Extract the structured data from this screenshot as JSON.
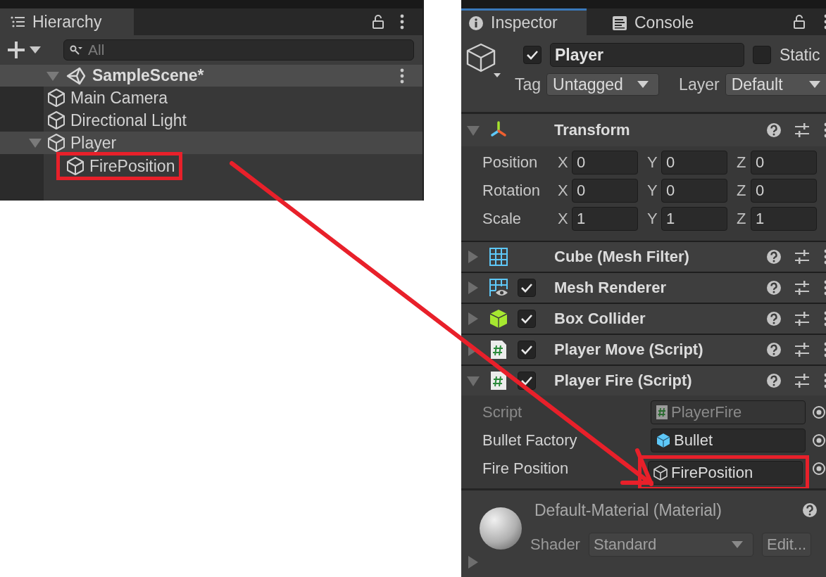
{
  "hierarchy": {
    "title": "Hierarchy",
    "search": {
      "placeholder": "All"
    },
    "scene": {
      "name": "SampleScene*",
      "expanded": true,
      "children": [
        {
          "name": "Main Camera",
          "selected": false,
          "annotated": false
        },
        {
          "name": "Directional Light",
          "selected": false,
          "annotated": false
        },
        {
          "name": "Player",
          "selected": true,
          "annotated": false,
          "expanded": true,
          "children": [
            {
              "name": "FirePosition",
              "selected": false,
              "annotated": true
            }
          ]
        }
      ]
    }
  },
  "inspector": {
    "tabs": [
      {
        "label": "Inspector",
        "selected": true
      },
      {
        "label": "Console",
        "selected": false
      }
    ],
    "object": {
      "active": true,
      "name": "Player",
      "static": false,
      "static_label": "Static",
      "tag_label": "Tag",
      "tag": "Untagged",
      "layer_label": "Layer",
      "layer": "Default"
    },
    "components": [
      {
        "kind": "transform",
        "name": "Transform",
        "expanded": true,
        "rows": [
          {
            "label": "Position",
            "fields": [
              {
                "axis": "X",
                "value": "0"
              },
              {
                "axis": "Y",
                "value": "0"
              },
              {
                "axis": "Z",
                "value": "0"
              }
            ]
          },
          {
            "label": "Rotation",
            "fields": [
              {
                "axis": "X",
                "value": "0"
              },
              {
                "axis": "Y",
                "value": "0"
              },
              {
                "axis": "Z",
                "value": "0"
              }
            ]
          },
          {
            "label": "Scale",
            "fields": [
              {
                "axis": "X",
                "value": "1"
              },
              {
                "axis": "Y",
                "value": "1"
              },
              {
                "axis": "Z",
                "value": "1"
              }
            ]
          }
        ]
      },
      {
        "kind": "mesh-filter",
        "name": "Cube (Mesh Filter)",
        "expanded": false
      },
      {
        "kind": "mesh-renderer",
        "name": "Mesh Renderer",
        "expanded": false,
        "enabled": true
      },
      {
        "kind": "box-collider",
        "name": "Box Collider",
        "expanded": false,
        "enabled": true
      },
      {
        "kind": "script",
        "name": "Player Move (Script)",
        "expanded": false,
        "enabled": true
      },
      {
        "kind": "script",
        "name": "Player Fire (Script)",
        "expanded": true,
        "enabled": true,
        "fields": [
          {
            "label": "Script",
            "value": "PlayerFire",
            "kind": "script",
            "disabled": true,
            "annotated": false
          },
          {
            "label": "Bullet Factory",
            "value": "Bullet",
            "kind": "prefab",
            "disabled": false,
            "annotated": false
          },
          {
            "label": "Fire Position",
            "value": "FirePosition",
            "kind": "object",
            "disabled": false,
            "annotated": true
          }
        ]
      }
    ],
    "material": {
      "name": "Default-Material (Material)",
      "shader_label": "Shader",
      "shader": "Standard",
      "edit": "Edit...",
      "expanded": false
    }
  }
}
